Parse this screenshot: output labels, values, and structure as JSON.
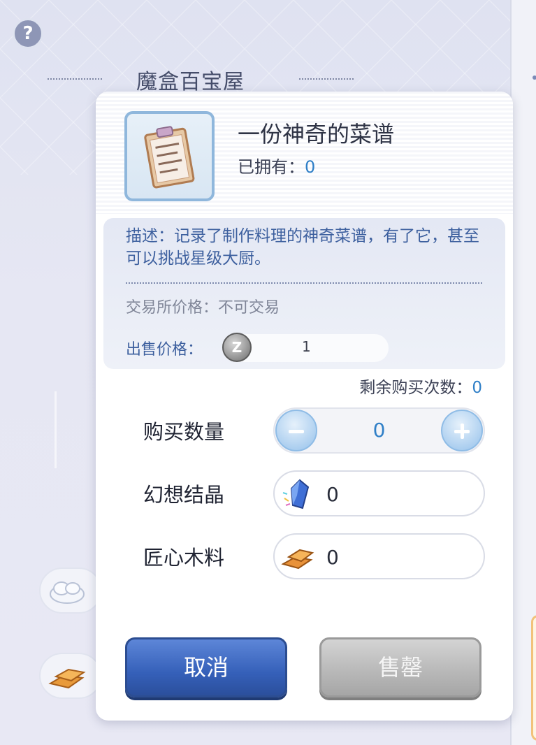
{
  "background": {
    "title": "魔盒百宝屋"
  },
  "dialog": {
    "item": {
      "name": "一份神奇的菜谱",
      "owned_label": "已拥有：",
      "owned_count": "0",
      "icon": "recipe-clipboard-icon"
    },
    "info": {
      "description": "描述：记录了制作料理的神奇菜谱，有了它，甚至可以挑战星级大厨。",
      "trade_price": "交易所价格：不可交易",
      "sell_label": "出售价格：",
      "sell_currency_icon": "zeny-coin-icon",
      "sell_currency_glyph": "Z",
      "sell_value": "1"
    },
    "remaining": {
      "label": "剩余购买次数：",
      "count": "0"
    },
    "quantity": {
      "label": "购买数量",
      "value": "0"
    },
    "costs": [
      {
        "label": "幻想结晶",
        "icon": "fantasy-crystal-icon",
        "value": "0"
      },
      {
        "label": "匠心木料",
        "icon": "craftsman-wood-icon",
        "value": "0"
      }
    ],
    "buttons": {
      "cancel": "取消",
      "sell": "售罄"
    }
  },
  "colors": {
    "accent_blue": "#2f7fc7",
    "cancel_button": "#3560b9",
    "soldout_button": "#b7b7b7"
  }
}
